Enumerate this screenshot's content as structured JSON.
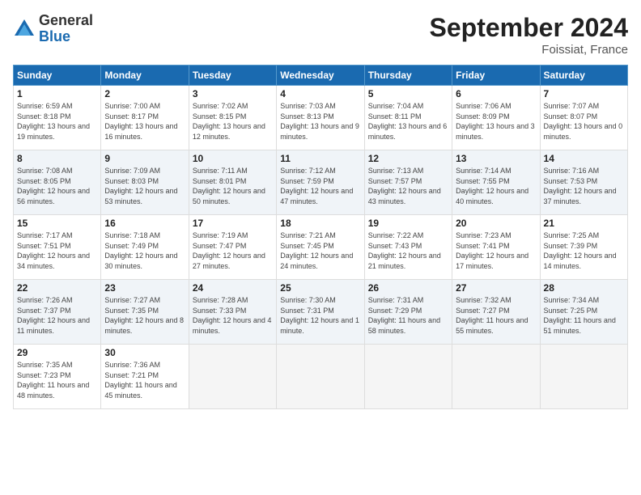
{
  "logo": {
    "general": "General",
    "blue": "Blue"
  },
  "title": "September 2024",
  "location": "Foissiat, France",
  "weekdays": [
    "Sunday",
    "Monday",
    "Tuesday",
    "Wednesday",
    "Thursday",
    "Friday",
    "Saturday"
  ],
  "days": [
    {
      "num": "1",
      "sunrise": "6:59 AM",
      "sunset": "8:18 PM",
      "daylight": "13 hours and 19 minutes."
    },
    {
      "num": "2",
      "sunrise": "7:00 AM",
      "sunset": "8:17 PM",
      "daylight": "13 hours and 16 minutes."
    },
    {
      "num": "3",
      "sunrise": "7:02 AM",
      "sunset": "8:15 PM",
      "daylight": "13 hours and 12 minutes."
    },
    {
      "num": "4",
      "sunrise": "7:03 AM",
      "sunset": "8:13 PM",
      "daylight": "13 hours and 9 minutes."
    },
    {
      "num": "5",
      "sunrise": "7:04 AM",
      "sunset": "8:11 PM",
      "daylight": "13 hours and 6 minutes."
    },
    {
      "num": "6",
      "sunrise": "7:06 AM",
      "sunset": "8:09 PM",
      "daylight": "13 hours and 3 minutes."
    },
    {
      "num": "7",
      "sunrise": "7:07 AM",
      "sunset": "8:07 PM",
      "daylight": "13 hours and 0 minutes."
    },
    {
      "num": "8",
      "sunrise": "7:08 AM",
      "sunset": "8:05 PM",
      "daylight": "12 hours and 56 minutes."
    },
    {
      "num": "9",
      "sunrise": "7:09 AM",
      "sunset": "8:03 PM",
      "daylight": "12 hours and 53 minutes."
    },
    {
      "num": "10",
      "sunrise": "7:11 AM",
      "sunset": "8:01 PM",
      "daylight": "12 hours and 50 minutes."
    },
    {
      "num": "11",
      "sunrise": "7:12 AM",
      "sunset": "7:59 PM",
      "daylight": "12 hours and 47 minutes."
    },
    {
      "num": "12",
      "sunrise": "7:13 AM",
      "sunset": "7:57 PM",
      "daylight": "12 hours and 43 minutes."
    },
    {
      "num": "13",
      "sunrise": "7:14 AM",
      "sunset": "7:55 PM",
      "daylight": "12 hours and 40 minutes."
    },
    {
      "num": "14",
      "sunrise": "7:16 AM",
      "sunset": "7:53 PM",
      "daylight": "12 hours and 37 minutes."
    },
    {
      "num": "15",
      "sunrise": "7:17 AM",
      "sunset": "7:51 PM",
      "daylight": "12 hours and 34 minutes."
    },
    {
      "num": "16",
      "sunrise": "7:18 AM",
      "sunset": "7:49 PM",
      "daylight": "12 hours and 30 minutes."
    },
    {
      "num": "17",
      "sunrise": "7:19 AM",
      "sunset": "7:47 PM",
      "daylight": "12 hours and 27 minutes."
    },
    {
      "num": "18",
      "sunrise": "7:21 AM",
      "sunset": "7:45 PM",
      "daylight": "12 hours and 24 minutes."
    },
    {
      "num": "19",
      "sunrise": "7:22 AM",
      "sunset": "7:43 PM",
      "daylight": "12 hours and 21 minutes."
    },
    {
      "num": "20",
      "sunrise": "7:23 AM",
      "sunset": "7:41 PM",
      "daylight": "12 hours and 17 minutes."
    },
    {
      "num": "21",
      "sunrise": "7:25 AM",
      "sunset": "7:39 PM",
      "daylight": "12 hours and 14 minutes."
    },
    {
      "num": "22",
      "sunrise": "7:26 AM",
      "sunset": "7:37 PM",
      "daylight": "12 hours and 11 minutes."
    },
    {
      "num": "23",
      "sunrise": "7:27 AM",
      "sunset": "7:35 PM",
      "daylight": "12 hours and 8 minutes."
    },
    {
      "num": "24",
      "sunrise": "7:28 AM",
      "sunset": "7:33 PM",
      "daylight": "12 hours and 4 minutes."
    },
    {
      "num": "25",
      "sunrise": "7:30 AM",
      "sunset": "7:31 PM",
      "daylight": "12 hours and 1 minute."
    },
    {
      "num": "26",
      "sunrise": "7:31 AM",
      "sunset": "7:29 PM",
      "daylight": "11 hours and 58 minutes."
    },
    {
      "num": "27",
      "sunrise": "7:32 AM",
      "sunset": "7:27 PM",
      "daylight": "11 hours and 55 minutes."
    },
    {
      "num": "28",
      "sunrise": "7:34 AM",
      "sunset": "7:25 PM",
      "daylight": "11 hours and 51 minutes."
    },
    {
      "num": "29",
      "sunrise": "7:35 AM",
      "sunset": "7:23 PM",
      "daylight": "11 hours and 48 minutes."
    },
    {
      "num": "30",
      "sunrise": "7:36 AM",
      "sunset": "7:21 PM",
      "daylight": "11 hours and 45 minutes."
    }
  ]
}
